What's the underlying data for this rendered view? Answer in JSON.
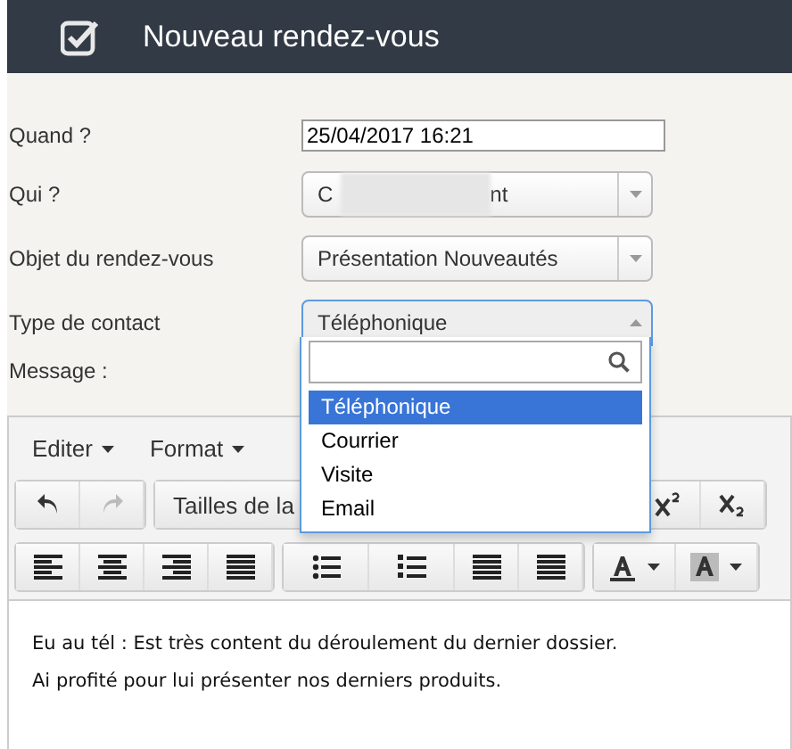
{
  "header": {
    "title": "Nouveau rendez-vous"
  },
  "fields": [
    {
      "kind": "input",
      "label": "Quand ?",
      "value": "25/04/2017 16:21"
    },
    {
      "kind": "select",
      "label": "Qui ?",
      "value_start": "C",
      "value_end": "nt",
      "redacted": true,
      "open": false
    },
    {
      "kind": "select",
      "label": "Objet du rendez-vous",
      "value": "Présentation Nouveautés",
      "open": false
    },
    {
      "kind": "select",
      "label": "Type de contact",
      "value": "Téléphonique",
      "open": true
    },
    {
      "kind": "label",
      "label": "Message :"
    }
  ],
  "dropdown": {
    "options": [
      {
        "label": "Téléphonique",
        "selected": true
      },
      {
        "label": "Courrier",
        "selected": false
      },
      {
        "label": "Visite",
        "selected": false
      },
      {
        "label": "Email",
        "selected": false
      }
    ]
  },
  "editor": {
    "menus": [
      "Editer",
      "Format"
    ],
    "font_size_placeholder": "Tailles de la",
    "content": [
      "Eu au tél : Est très content du déroulement du dernier dossier.",
      "Ai profité pour lui présenter nos derniers produits."
    ]
  }
}
